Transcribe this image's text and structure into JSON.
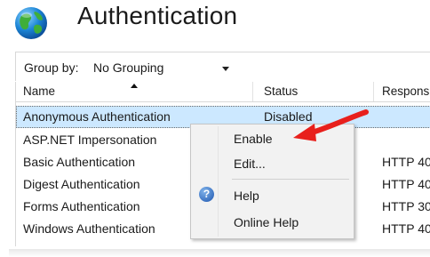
{
  "header": {
    "title": "Authentication"
  },
  "toolbar": {
    "group_by_label": "Group by:",
    "group_by_value": "No Grouping"
  },
  "columns": {
    "name": "Name",
    "status": "Status",
    "response": "Respons"
  },
  "rows": [
    {
      "name": "Anonymous Authentication",
      "status": "Disabled",
      "response": ""
    },
    {
      "name": "ASP.NET Impersonation",
      "status": "",
      "response": ""
    },
    {
      "name": "Basic Authentication",
      "status": "",
      "response": "HTTP 40"
    },
    {
      "name": "Digest Authentication",
      "status": "",
      "response": "HTTP 40"
    },
    {
      "name": "Forms Authentication",
      "status": "",
      "response": "HTTP 30"
    },
    {
      "name": "Windows Authentication",
      "status": "",
      "response": "HTTP 40"
    }
  ],
  "context_menu": {
    "enable": "Enable",
    "edit": "Edit...",
    "help": "Help",
    "online_help": "Online Help"
  },
  "icons": {
    "header": "globe-icon",
    "help": "help-icon",
    "annotation": "red-arrow-icon"
  },
  "colors": {
    "selection": "#cce8ff",
    "arrow": "#e8201c",
    "help_icon": "#1f57b0"
  }
}
